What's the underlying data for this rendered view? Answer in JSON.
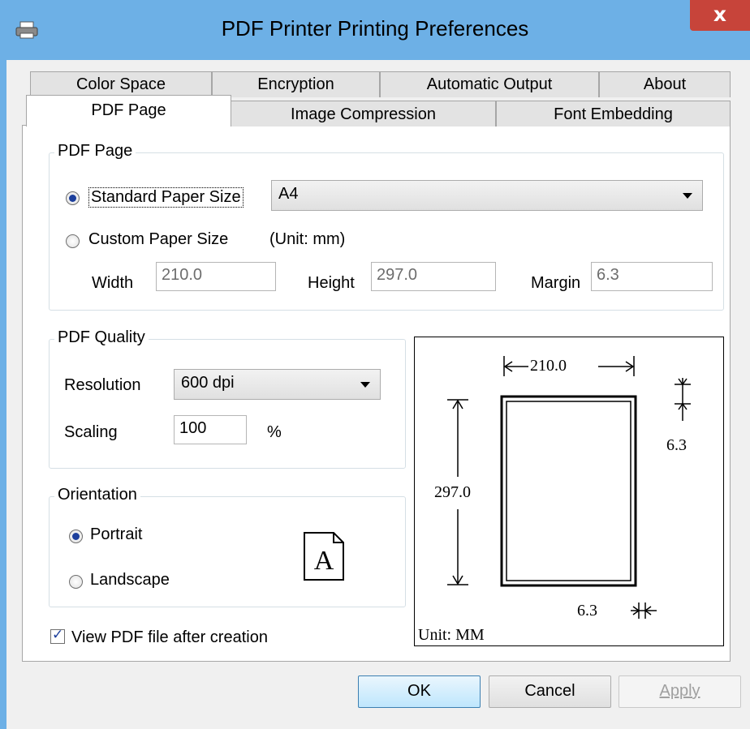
{
  "window": {
    "title": "PDF Printer Printing Preferences",
    "close_glyph": "x"
  },
  "tabs": {
    "row1": [
      "Color Space",
      "Encryption",
      "Automatic Output",
      "About"
    ],
    "row2": [
      "PDF Page",
      "Image Compression",
      "Font Embedding"
    ],
    "active": "PDF Page"
  },
  "pdf_page_group": {
    "legend": "PDF Page",
    "standard_label": "Standard Paper Size",
    "standard_selected": true,
    "paper_size": "A4",
    "custom_label": "Custom Paper Size",
    "custom_selected": false,
    "unit_note": "(Unit: mm)",
    "width_label": "Width",
    "width_value": "210.0",
    "height_label": "Height",
    "height_value": "297.0",
    "margin_label": "Margin",
    "margin_value": "6.3"
  },
  "quality_group": {
    "legend": "PDF Quality",
    "resolution_label": "Resolution",
    "resolution_value": "600 dpi",
    "scaling_label": "Scaling",
    "scaling_value": "100",
    "scaling_unit": "%"
  },
  "orientation_group": {
    "legend": "Orientation",
    "portrait_label": "Portrait",
    "portrait_selected": true,
    "landscape_label": "Landscape",
    "landscape_selected": false,
    "preview_letter": "A"
  },
  "view_after_creation": {
    "label": "View PDF file after creation",
    "checked": true
  },
  "preview": {
    "width": "210.0",
    "height": "297.0",
    "margin_top": "6.3",
    "margin_bottom": "6.3",
    "unit": "Unit: MM"
  },
  "buttons": {
    "ok": "OK",
    "cancel": "Cancel",
    "apply": "Apply",
    "apply_enabled": false
  }
}
